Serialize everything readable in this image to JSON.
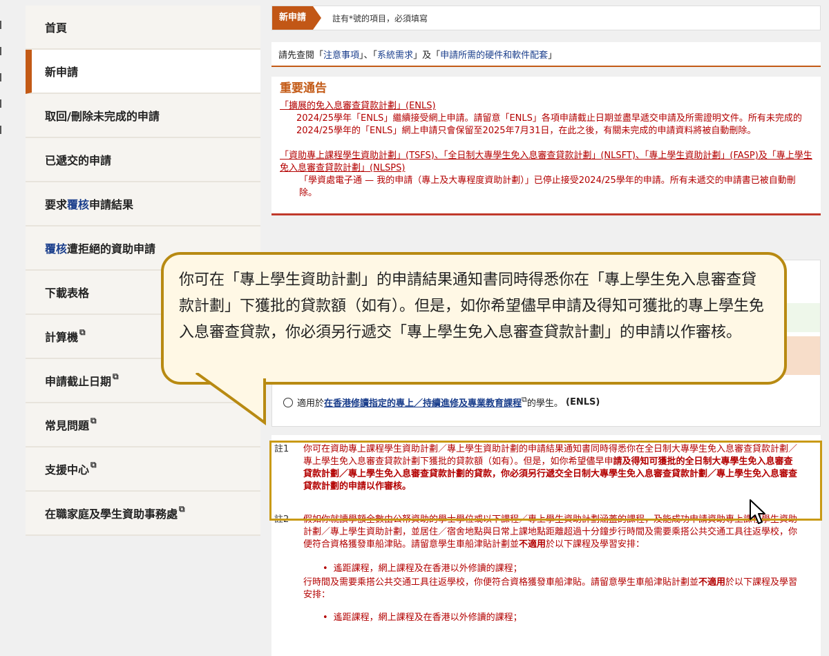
{
  "sidebar": {
    "items": [
      {
        "label": "首頁"
      },
      {
        "label": "新申請"
      },
      {
        "label": "取回/刪除未完成的申請"
      },
      {
        "label": "已遞交的申請"
      },
      {
        "label_pre": "要求",
        "label_hl": "覆核",
        "label_post": "申請結果"
      },
      {
        "label_hl": "覆核",
        "label_post": "遭拒絕的資助申請"
      },
      {
        "label": "下載表格"
      },
      {
        "label": "計算機"
      },
      {
        "label": "申請截止日期"
      },
      {
        "label": "常見問題"
      },
      {
        "label": "支援中心"
      },
      {
        "label": "在職家庭及學生資助事務處"
      }
    ],
    "external_icon": "external-link-icon"
  },
  "topbar": {
    "tag": "新申請",
    "note": "註有*號的項目，必須填寫"
  },
  "readfirst": {
    "pre": "請先查閱「",
    "link1": "注意事項",
    "mid1": "」、「",
    "link2": "系統需求",
    "mid2": "」及「",
    "link3": "申請所需的硬件和軟件配套",
    "post": "」"
  },
  "notice": {
    "title": "重要通告",
    "block1_heading": "「擴展的免入息審查貸款計劃」(ENLS)",
    "block1_text": "2024/25學年「ENLS」繼續接受網上申請。請留意「ENLS」各項申請截止日期並盡早遞交申請及所需證明文件。所有未完成的2024/25學年的「ENLS」網上申請只會保留至2025年7月31日，在此之後，有關未完成的申請資料將被自動刪除。",
    "block2_heading": "「資助專上課程學生資助計劃」(TSFS)、「全日制大專學生免入息審查貸款計劃」(NLSFT)、「專上學生資助計劃」(FASP)及「專上學生免入息審查貸款計劃」(NLSPS)",
    "block2_text": "「學資處電子通 — 我的申請（專上及大專程度資助計劃）」已停止接受2024/25學年的申請。所有未遞交的申請書已被自動刪除。"
  },
  "form": {
    "radio_pre": "適用於",
    "radio_link": "在香港修讀指定的專上／持續進修及專業教育課程",
    "radio_post": "的學生。",
    "radio_code": "(ENLS)"
  },
  "notes": {
    "note1_label": "註1",
    "note1_text": "你可在資助專上課程學生資助計劃／專上學生資助計劃的申請結果通知書同時得悉你在全日制大專學生免入息審查貸款計劃／專上學生免入息審查貸款計劃下獲批的貸款額（如有）。但是，如你希望儘早申",
    "note1_bold": "請及得知可獲批的全日制大專學生免入息審查貸款計劃／專上學生免入息審查貸款計劃的貸款，你必須另行遞交全日制大專學生免入息審查貸款計劃／專上學生免入息審查貸款計劃的申請以作審核。",
    "note2_label": "註2",
    "note2_text": "假如你就讀學額全數由公帑資助的學士學位或以下課程／專上學生資助計劃涵蓋的課程，及能成功申請資助專上課程學生資助計劃／專上學生資助計劃，並居住／宿舍地點與日常上課地點距離超過十分鐘步行時間及需要乘搭公共交通工具往返學校，你便符合資格獲發車船津貼。請留意學生車船津貼計劃並",
    "note2_bold": "不適用",
    "note2_post": "於以下課程及學習安排：",
    "bullet1": "遙距課程，網上課程及在香港以外修讀的課程；",
    "repeat_line1": "行時間及需要乘搭公共交通工具往返學校，你便符合資格獲發車船津貼。請留意學生車船津貼計劃並",
    "repeat_bold": "不適用",
    "repeat_post": "於以下課程及學習安排：",
    "bullet2": "遙距課程，網上課程及在香港以外修讀的課程；"
  },
  "callout": {
    "text": "你可在「專上學生資助計劃」的申請結果通知書同時得悉你在「專上學生免入息審查貸款計劃」下獲批的貸款額（如有）。但是，如你希望儘早申請及得知可獲批的專上學生免入息審查貸款，你必須另行遞交「專上學生免入息審查貸款計劃」的申請以作審核。"
  },
  "colors": {
    "accent": "#c35a16",
    "notice_red": "#b30000",
    "link_blue": "#1a3e8c",
    "callout_border": "#b88a12",
    "highlight_box": "#c99a16"
  }
}
